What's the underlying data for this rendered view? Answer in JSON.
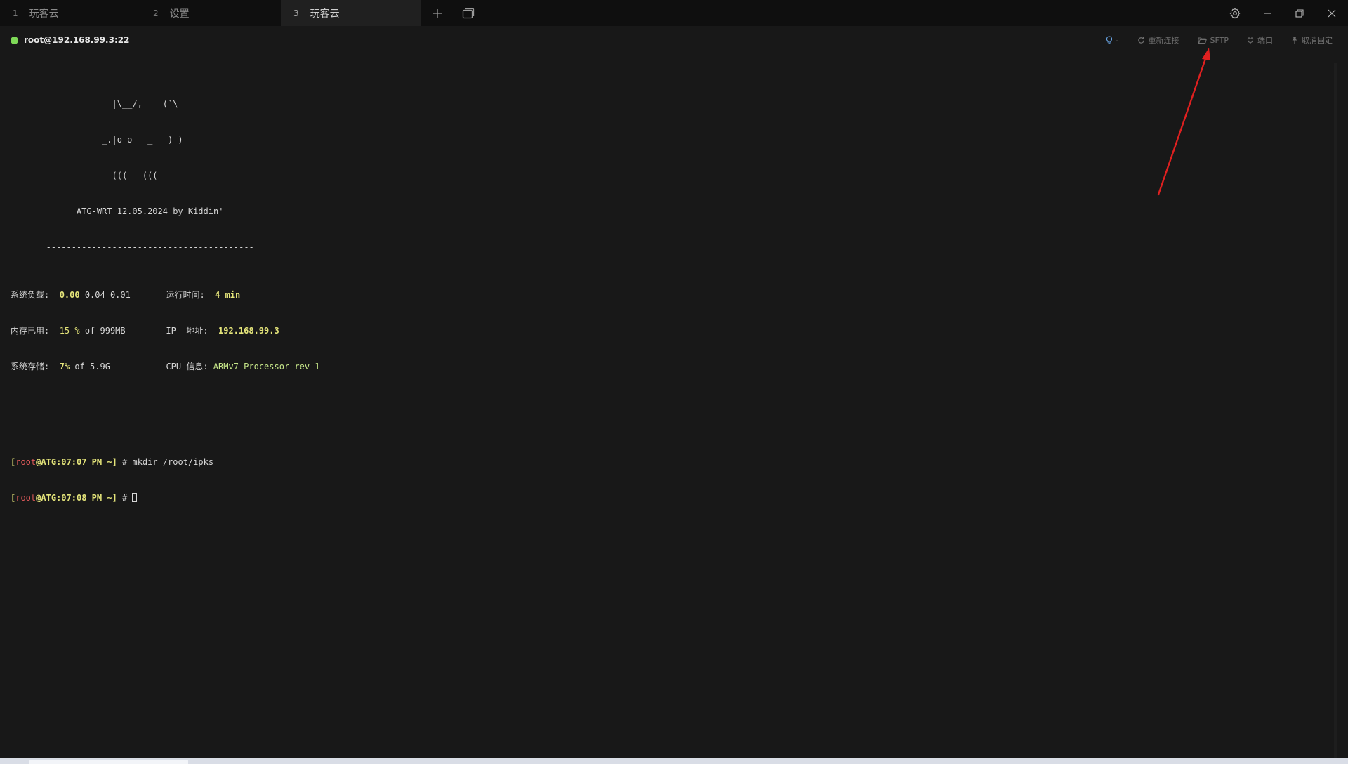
{
  "tabs": [
    {
      "num": "1",
      "label": "玩客云"
    },
    {
      "num": "2",
      "label": "设置"
    },
    {
      "num": "3",
      "label": "玩客云"
    }
  ],
  "session": {
    "host": "root@192.168.99.3:22",
    "status_color": "#7ed957",
    "actions": {
      "hint_label": "-",
      "reconnect": "重新连接",
      "sftp": "SFTP",
      "port": "端口",
      "unpin": "取消固定"
    }
  },
  "terminal": {
    "banner": [
      "                    |\\__/,|   (`\\",
      "                  _.|o o  |_   ) )",
      "       -------------(((---(((-------------------",
      "             ATG-WRT 12.05.2024 by Kiddin'",
      "       -----------------------------------------"
    ],
    "stats": {
      "load_label": "系统负载:",
      "load_first": "0.00",
      "load_rest": "0.04 0.01",
      "uptime_label": "运行时间:",
      "uptime_value": "4 min",
      "mem_label": "内存已用:",
      "mem_value": "15 %",
      "mem_total": "of 999MB",
      "ip_label": "IP  地址:",
      "ip_value": "192.168.99.3",
      "storage_label": "系统存储:",
      "storage_value": "7%",
      "storage_total": "of 5.9G",
      "cpu_label": "CPU 信息:",
      "cpu_value": "ARMv7 Processor rev 1"
    },
    "prompts": [
      {
        "user": "root",
        "host": "ATG",
        "time": "07:07 PM",
        "dir": "~",
        "command": "mkdir /root/ipks"
      },
      {
        "user": "root",
        "host": "ATG",
        "time": "07:08 PM",
        "dir": "~",
        "command": ""
      }
    ]
  },
  "colors": {
    "annotation_arrow": "#e02020"
  }
}
